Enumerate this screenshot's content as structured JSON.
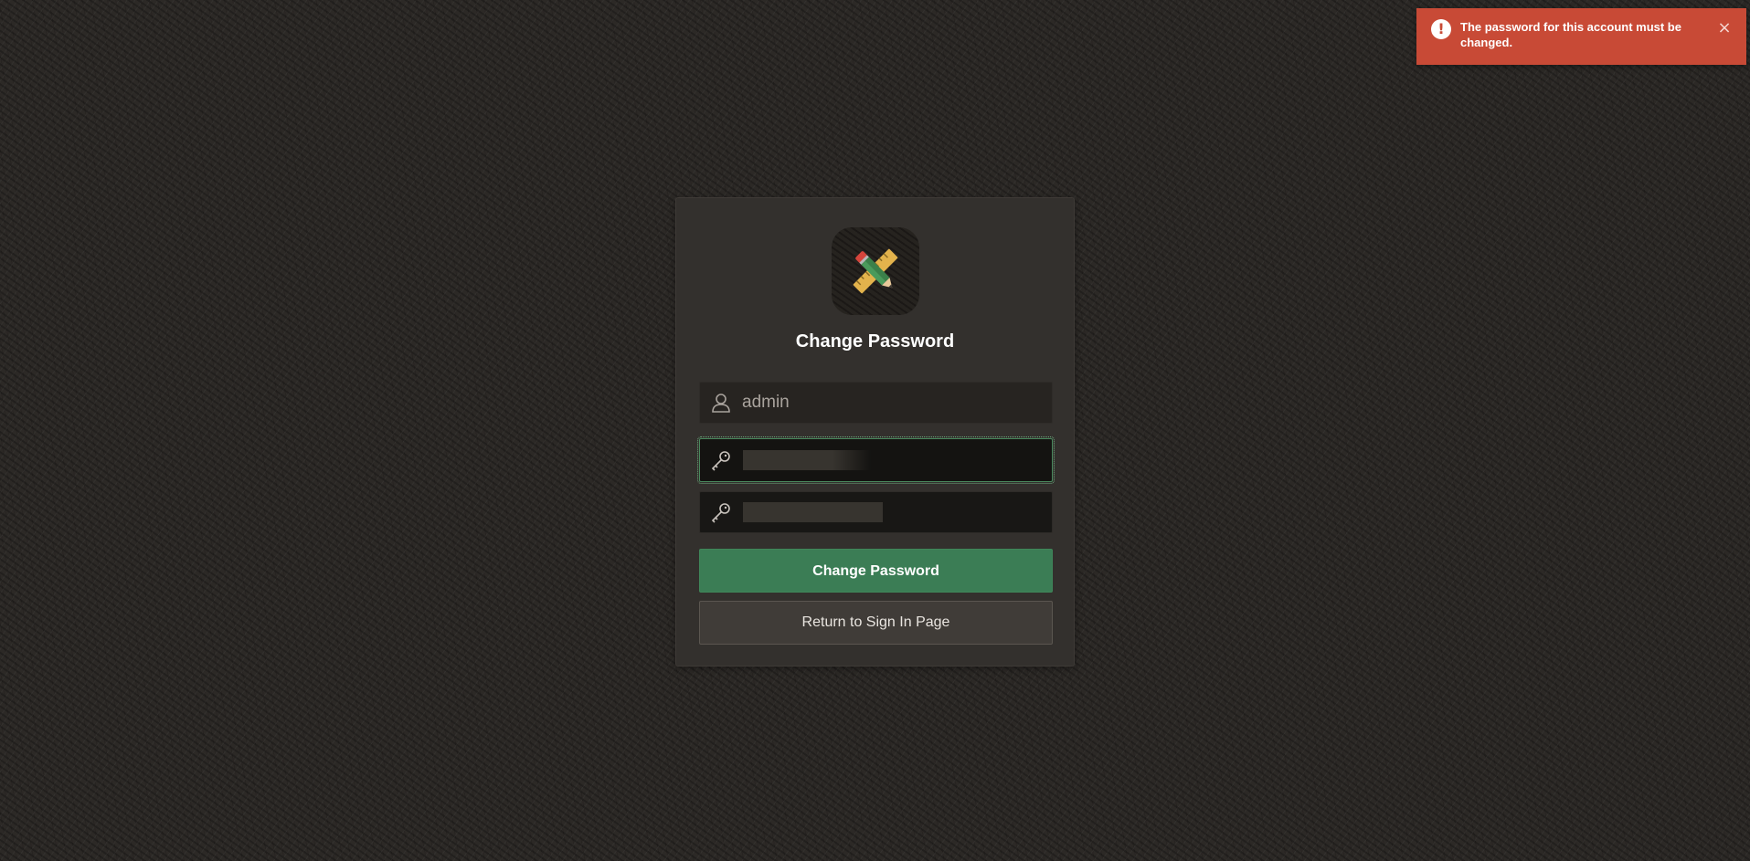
{
  "notification": {
    "message": "The password for this account must be changed.",
    "status_icon": "exclamation-icon",
    "close_icon": "close-icon",
    "icon_glyph": "!",
    "close_glyph": "×",
    "color": "#c84a36"
  },
  "app": {
    "logo_icon": "pencil-ruler-icon"
  },
  "form": {
    "title": "Change Password",
    "username": {
      "value": "admin",
      "icon": "user-icon"
    },
    "new_password": {
      "icon": "key-icon",
      "state": "focused, redacted"
    },
    "confirm_password": {
      "icon": "key-icon",
      "state": "redacted"
    },
    "submit_label": "Change Password",
    "return_label": "Return to Sign In Page",
    "colors": {
      "primary": "#3b7d55",
      "secondary": "#403c38"
    }
  }
}
